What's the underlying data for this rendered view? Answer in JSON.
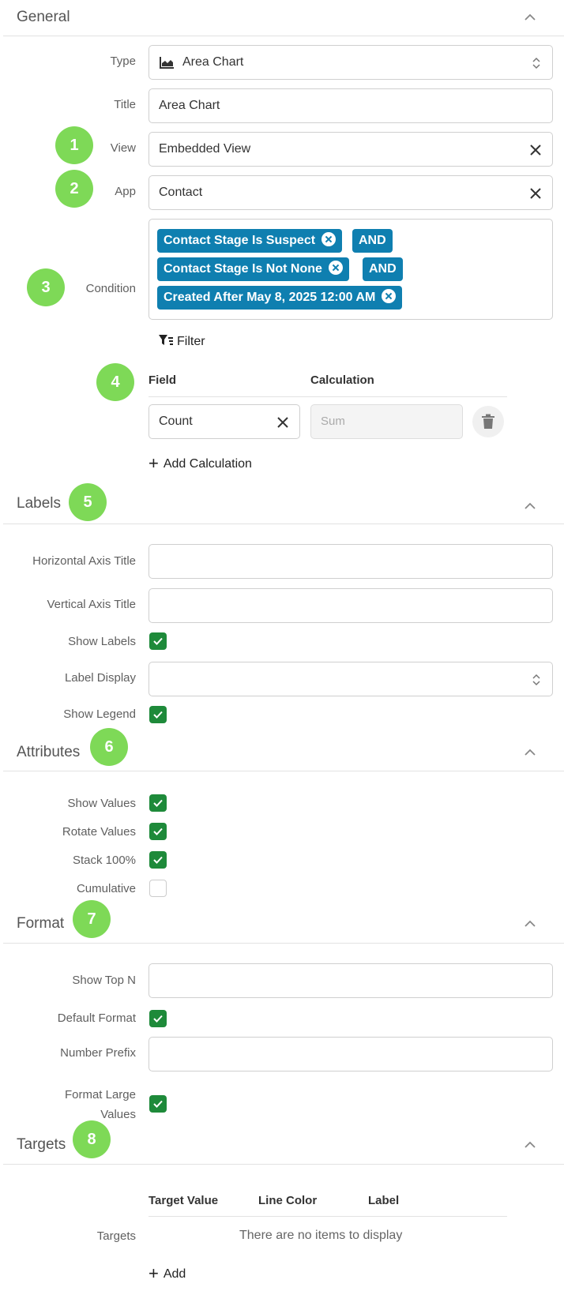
{
  "sections": {
    "general": "General",
    "labels": "Labels",
    "attributes": "Attributes",
    "format": "Format",
    "targets": "Targets"
  },
  "general": {
    "type_label": "Type",
    "type_value": "Area Chart",
    "title_label": "Title",
    "title_value": "Area Chart",
    "view_label": "View",
    "view_value": "Embedded View",
    "app_label": "App",
    "app_value": "Contact",
    "condition_label": "Condition",
    "conditions": [
      "Contact Stage Is Suspect",
      "Contact Stage Is Not None",
      "Created After May 8, 2025 12:00 AM"
    ],
    "and_label": "AND",
    "filter_label": "Filter",
    "field_header": "Field",
    "calculation_header": "Calculation",
    "field_value": "Count",
    "calculation_placeholder": "Sum",
    "add_calculation": "Add Calculation"
  },
  "labels": {
    "horizontal_axis_title": "Horizontal Axis Title",
    "vertical_axis_title": "Vertical Axis Title",
    "show_labels": "Show Labels",
    "label_display": "Label Display",
    "show_legend": "Show Legend"
  },
  "attributes": {
    "show_values": "Show Values",
    "rotate_values": "Rotate Values",
    "stack_100": "Stack 100%",
    "cumulative": "Cumulative"
  },
  "format": {
    "show_top_n": "Show Top N",
    "default_format": "Default Format",
    "number_prefix": "Number Prefix",
    "format_large_values_1": "Format Large",
    "format_large_values_2": "Values"
  },
  "targets": {
    "target_value_header": "Target Value",
    "line_color_header": "Line Color",
    "label_header": "Label",
    "targets_label": "Targets",
    "empty_message": "There are no items to display",
    "add_label": "Add"
  },
  "badges": [
    "1",
    "2",
    "3",
    "4",
    "5",
    "6",
    "7",
    "8"
  ],
  "colors": {
    "badge": "#7ed957",
    "tag": "#0f7fb0",
    "checkbox": "#1e8a3a"
  }
}
